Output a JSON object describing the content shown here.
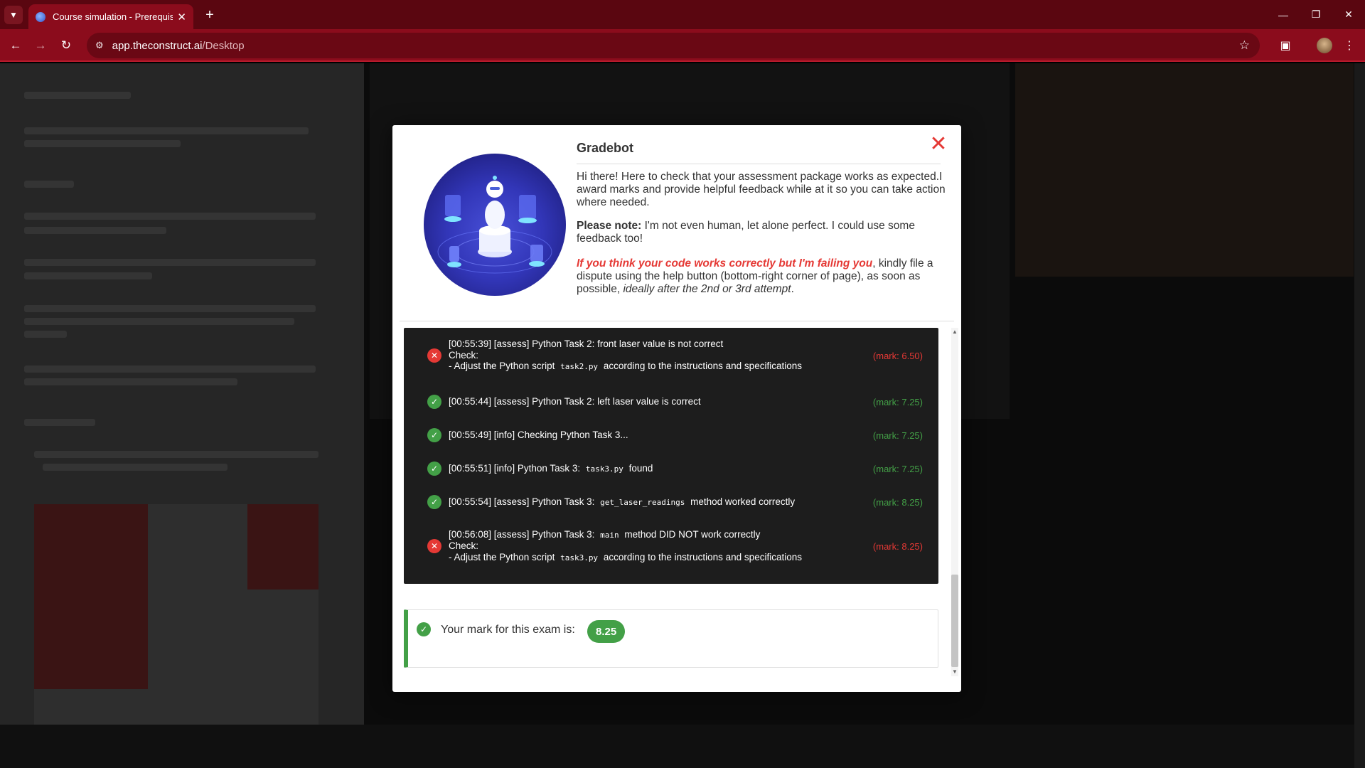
{
  "browser": {
    "tab_title": "Course simulation - Prerequisit",
    "url_host": "app.theconstruct.ai",
    "url_path": "/Desktop"
  },
  "modal": {
    "title": "Gradebot",
    "intro": "Hi there! Here to check that your assessment package works as expected.I award marks and provide helpful feedback while at it so you can take action where needed.",
    "note_label": "Please note:",
    "note_text": " I'm not even human, let alone perfect. I could use some feedback too!",
    "dispute_em": "If you think your code works correctly but I'm failing you",
    "dispute_text": ", kindly file a dispute using the help button (bottom-right corner of page), as soon as possible, ",
    "dispute_tail": "ideally after the 2nd or 3rd attempt",
    "dispute_end": "."
  },
  "log": [
    {
      "status": "error",
      "line1": "[00:55:39] [assess] Python Task 2: front laser value is not correct",
      "line2": "Check:",
      "line3_pre": "- Adjust the Python script ",
      "line3_code": "task2.py",
      "line3_post": " according to the instructions and specifications",
      "mark": "(mark: 6.50)"
    },
    {
      "status": "ok",
      "line1": "[00:55:44] [assess] Python Task 2: left laser value is correct",
      "mark": "(mark: 7.25)"
    },
    {
      "status": "ok",
      "line1": "[00:55:49] [info] Checking Python Task 3...",
      "mark": "(mark: 7.25)"
    },
    {
      "status": "ok",
      "line1_pre": "[00:55:51] [info] Python Task 3: ",
      "line1_code": "task3.py",
      "line1_post": " found",
      "mark": "(mark: 7.25)"
    },
    {
      "status": "ok",
      "line1_pre": "[00:55:54] [assess] Python Task 3: ",
      "line1_code": "get_laser_readings",
      "line1_post": " method worked correctly",
      "mark": "(mark: 8.25)"
    },
    {
      "status": "error",
      "line1_pre": "[00:56:08] [assess] Python Task 3: ",
      "line1_code": "main",
      "line1_post": " method DID NOT work correctly",
      "line2": "Check:",
      "line3_pre": "- Adjust the Python script ",
      "line3_code": "task3.py",
      "line3_post": " according to the instructions and specifications",
      "mark": "(mark: 8.25)"
    }
  ],
  "result": {
    "label": "Your mark for this exam is:",
    "score": "8.25"
  },
  "colors": {
    "error": "#e53935",
    "success": "#43a047",
    "browser_frame": "#8b0c1c"
  }
}
